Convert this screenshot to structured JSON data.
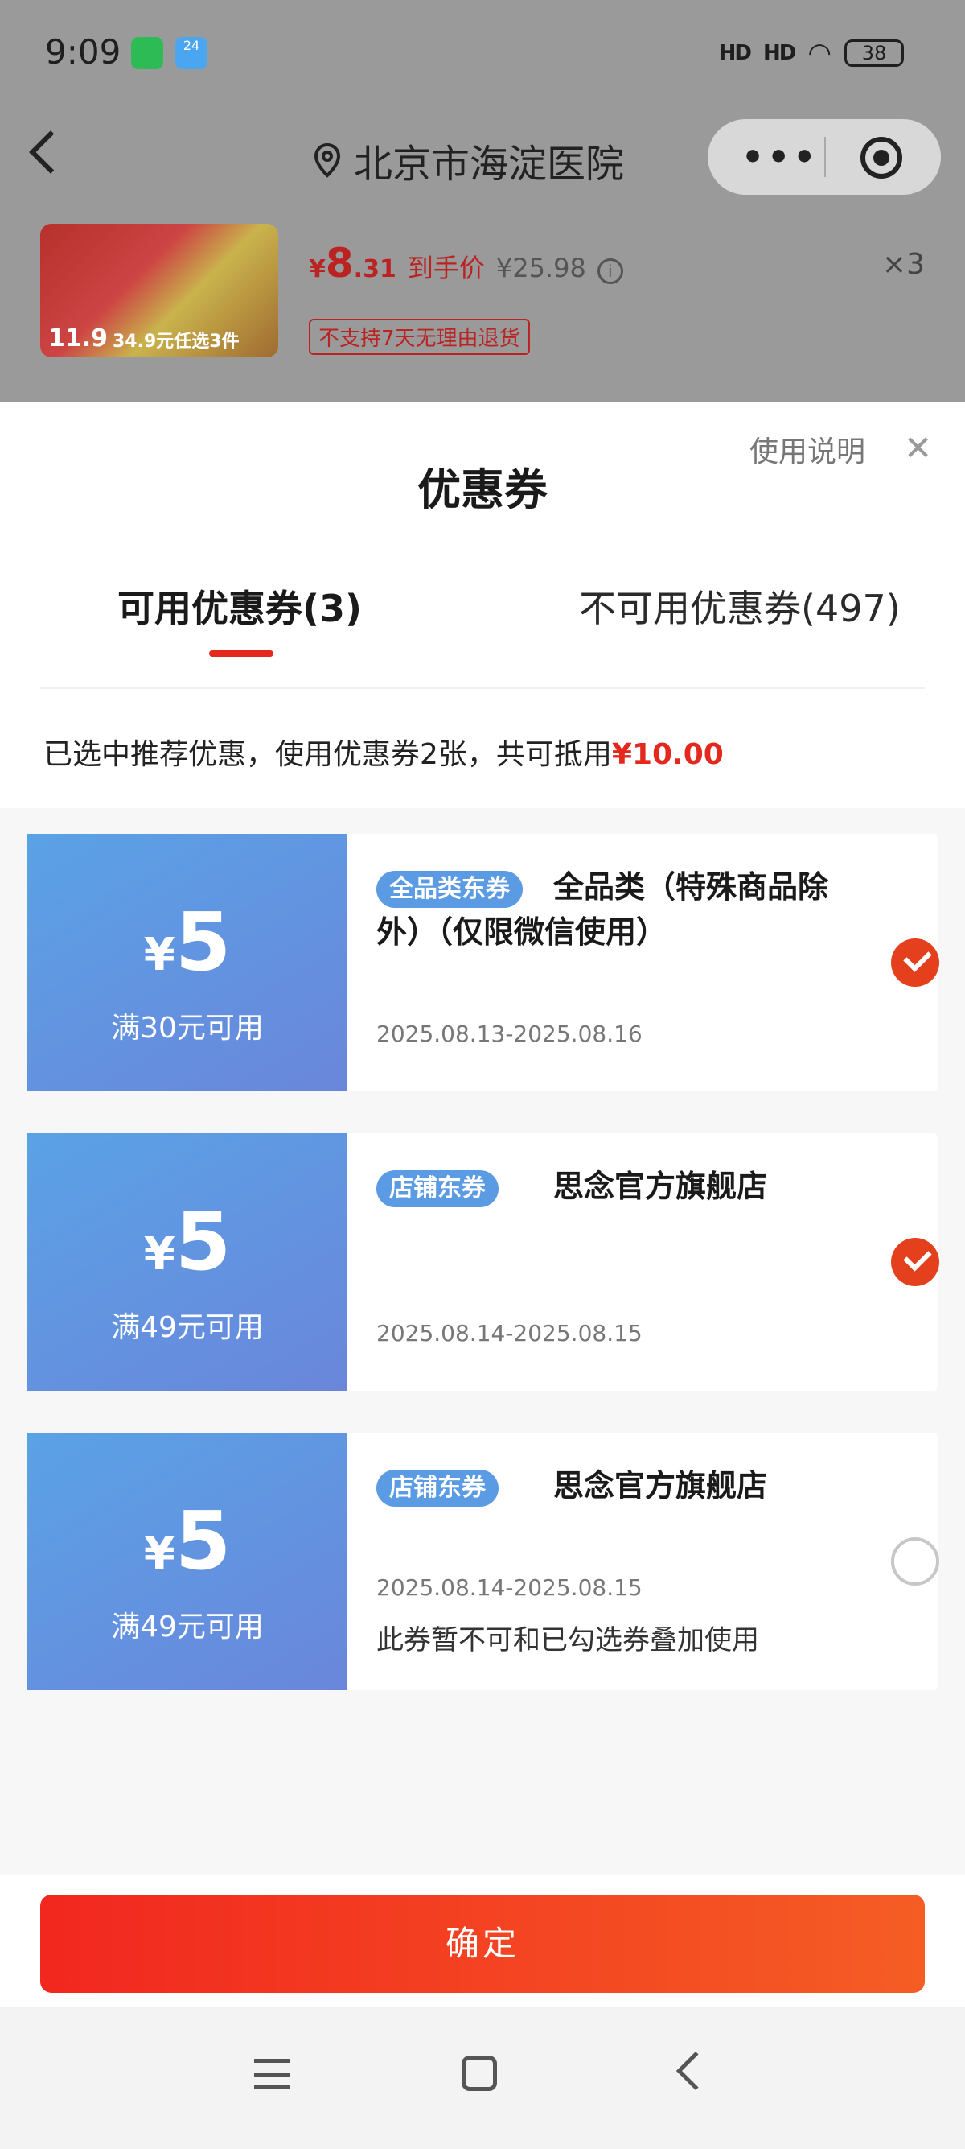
{
  "status_bar": {
    "time": "9:09",
    "weather_badge": "24",
    "signal_label": "HD",
    "battery": "38",
    "icons": [
      "wechat-icon",
      "weather-icon",
      "signal-icon",
      "wifi-icon",
      "battery-icon"
    ]
  },
  "nav": {
    "location": "北京市海淀医院",
    "icons": [
      "back-icon",
      "location-pin-icon",
      "more-dots-icon",
      "target-icon"
    ]
  },
  "product": {
    "thumb_text_price": "11.9",
    "thumb_text_deal": "34.9元任选3件",
    "price_yen": "¥",
    "price_int": "8",
    "price_dec": ".31",
    "price_label": "到手价",
    "original_price": "¥25.98",
    "quantity": "×3",
    "refund_badge": "不支持7天无理由退货"
  },
  "sheet": {
    "title": "优惠券",
    "help_link": "使用说明",
    "close": "✕",
    "tabs": [
      {
        "label": "可用优惠券(3)",
        "active": true
      },
      {
        "label": "不可用优惠券(497)",
        "active": false
      }
    ],
    "summary_text": "已选中推荐优惠，使用优惠券2张，共可抵用",
    "summary_amount": "¥10.00"
  },
  "coupons": [
    {
      "yen": "¥",
      "amount": "5",
      "threshold": "满30元可用",
      "type": "全品类东券",
      "name": "全品类（特殊商品除外）（仅限微信使用）",
      "date": "2025.08.13-2025.08.16",
      "note": "",
      "selected": true
    },
    {
      "yen": "¥",
      "amount": "5",
      "threshold": "满49元可用",
      "type": "店铺东券",
      "name": "思念官方旗舰店",
      "date": "2025.08.14-2025.08.15",
      "note": "",
      "selected": true
    },
    {
      "yen": "¥",
      "amount": "5",
      "threshold": "满49元可用",
      "type": "店铺东券",
      "name": "思念官方旗舰店",
      "date": "2025.08.14-2025.08.15",
      "note": "此券暂不可和已勾选券叠加使用",
      "selected": false
    }
  ],
  "confirm_button": "确定",
  "colors": {
    "accent_red": "#e5281d",
    "coupon_gradient_start": "#5aa2e6",
    "coupon_gradient_end": "#6a86db",
    "type_badge": "#5b9be3",
    "button_start": "#f2271f",
    "button_end": "#f55d24"
  }
}
